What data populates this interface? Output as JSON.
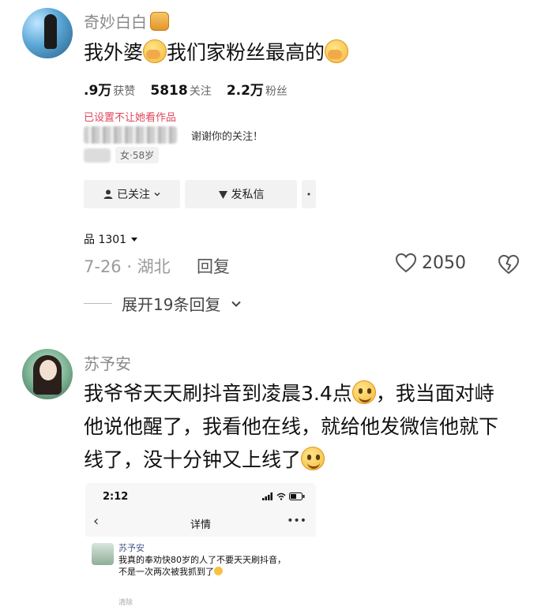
{
  "comment1": {
    "username": "奇妙白白",
    "text_a": "我外婆",
    "text_b": "我们家粉丝最高的",
    "profile": {
      "likes_value": ".9万",
      "likes_label": "获赞",
      "following_value": "5818",
      "following_label": "关注",
      "followers_value": "2.2万",
      "followers_label": "粉丝",
      "privacy_note": "已设置不让她看作品",
      "thanks_text": "谢谢你的关注！",
      "tag": "女·58岁",
      "followed_button": "已关注",
      "message_button": "发私信",
      "works_count": "品 1301"
    },
    "date_location": "7-26 · 湖北",
    "reply_label": "回复",
    "like_count": "2050",
    "expand_label": "展开19条回复"
  },
  "comment2": {
    "username": "苏予安",
    "line1": "我爷爷天天刷抖音到凌晨3.4点",
    "line1_end": "，我当面对峙",
    "line2": "他说他醒了，我看他在线，就给他发微信他就下",
    "line3": "线了，没十分钟又上线了",
    "phone": {
      "time": "2:12",
      "title": "详情",
      "sender": "苏予安",
      "message_line1": "我真的奉劝快80岁的人了不要天天刷抖音，",
      "message_line2": "不是一次两次被我抓到了",
      "bottom_label": "清除"
    }
  },
  "icons": [
    "honey-jar-badge-icon",
    "face-with-hand-emoji-icon",
    "smile-emoji-icon",
    "user-icon",
    "send-icon",
    "heart-icon",
    "broken-heart-icon",
    "chevron-down-icon",
    "back-icon",
    "more-icon",
    "signal-icon",
    "wifi-icon",
    "battery-icon"
  ]
}
